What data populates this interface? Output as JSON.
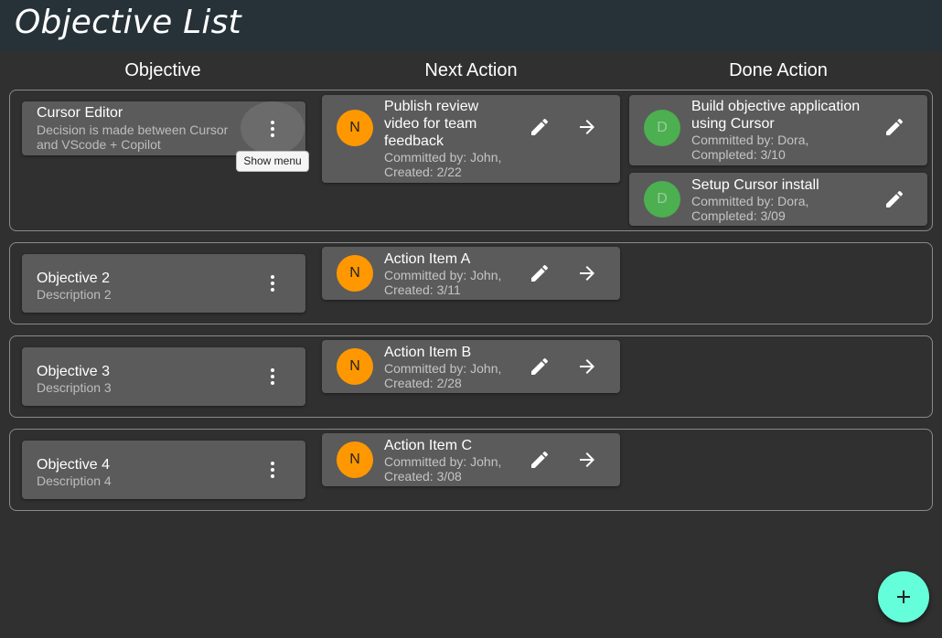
{
  "app": {
    "title": "Objective List"
  },
  "columns": {
    "objective": "Objective",
    "next_action": "Next Action",
    "done_action": "Done Action"
  },
  "tooltip": {
    "text": "Show menu"
  },
  "objectives": [
    {
      "title": "Cursor Editor",
      "description": "Decision is made between Cursor and VScode + Copilot",
      "description_lines": [
        "Decision is made between Cursor",
        "and VScode + Copilot"
      ],
      "next_action": {
        "avatar": "N",
        "title_lines": [
          "Publish review",
          "video for team",
          "feedback"
        ],
        "meta_lines": [
          "Committed by: John,",
          "Created: 2/22"
        ]
      },
      "done_actions": [
        {
          "avatar": "D",
          "title_lines": [
            "Build objective application",
            "using Cursor"
          ],
          "meta_lines": [
            "Committed by: Dora,",
            "Completed: 3/10"
          ]
        },
        {
          "avatar": "D",
          "title_lines": [
            "Setup Cursor install"
          ],
          "meta_lines": [
            "Committed by: Dora,",
            "Completed: 3/09"
          ]
        }
      ]
    },
    {
      "title": "Objective 2",
      "description": "Description 2",
      "next_action": {
        "avatar": "N",
        "title_lines": [
          "Action Item A"
        ],
        "meta_lines": [
          "Committed by: John,",
          "Created: 3/11"
        ]
      },
      "done_actions": []
    },
    {
      "title": "Objective 3",
      "description": "Description 3",
      "next_action": {
        "avatar": "N",
        "title_lines": [
          "Action Item B"
        ],
        "meta_lines": [
          "Committed by: John,",
          "Created: 2/28"
        ]
      },
      "done_actions": []
    },
    {
      "title": "Objective 4",
      "description": "Description 4",
      "next_action": {
        "avatar": "N",
        "title_lines": [
          "Action Item C"
        ],
        "meta_lines": [
          "Committed by: John,",
          "Created: 3/08"
        ]
      },
      "done_actions": []
    }
  ],
  "icons": {
    "menu": "more-vert-icon",
    "edit": "pencil-icon",
    "advance": "arrow-right-icon",
    "add": "plus-icon"
  },
  "colors": {
    "appbar": "#263238",
    "background": "#303030",
    "card": "#5b5b5b",
    "next_avatar": "#ff9800",
    "done_avatar": "#4caf50",
    "fab": "#64ffda"
  }
}
